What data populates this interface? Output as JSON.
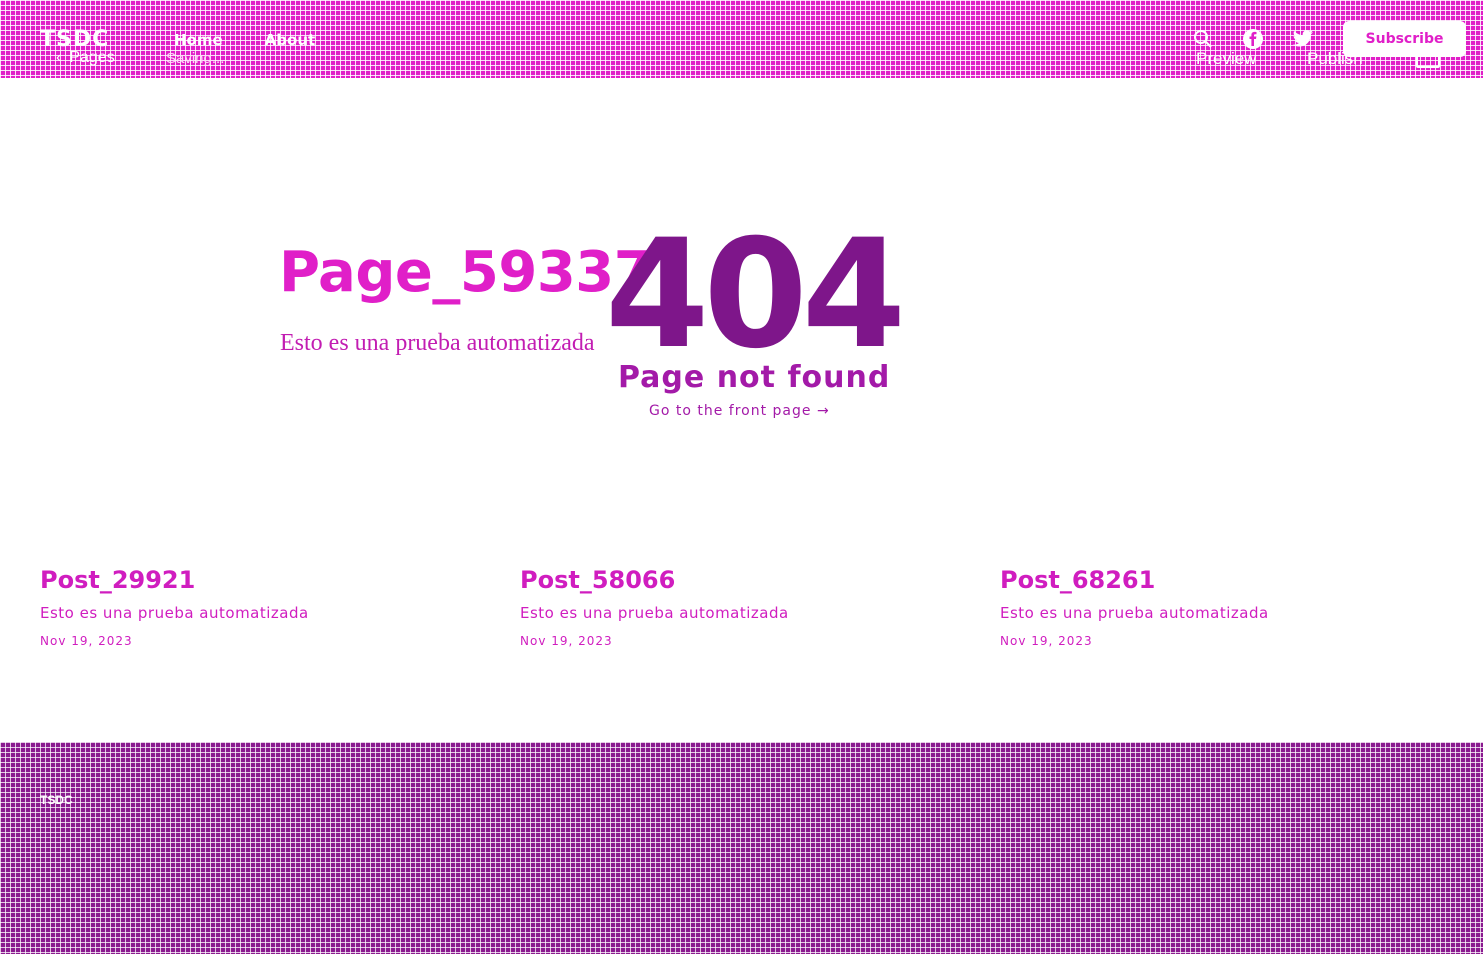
{
  "header": {
    "logo": "TSDC",
    "nav": [
      {
        "label": "Home"
      },
      {
        "label": "About"
      }
    ],
    "editor": {
      "back_arrow": "‹",
      "back_label": "Pages",
      "status": "Saving...",
      "preview_label": "Preview",
      "publish_label": "Publish"
    },
    "icons": [
      "search-icon",
      "facebook-icon",
      "twitter-icon"
    ],
    "subscribe_label": "Subscribe"
  },
  "main": {
    "page_title": "Page_59337",
    "page_description": "Esto es una prueba automatizada",
    "error_code": "404",
    "error_message": "Page not found",
    "front_link": "Go to the front page →"
  },
  "posts": [
    {
      "title": "Post_29921",
      "excerpt": "Esto es una prueba automatizada",
      "date": "Nov 19, 2023"
    },
    {
      "title": "Post_58066",
      "excerpt": "Esto es una prueba automatizada",
      "date": "Nov 19, 2023"
    },
    {
      "title": "Post_68261",
      "excerpt": "Esto es una prueba automatizada",
      "date": "Nov 19, 2023"
    }
  ],
  "footer": {
    "brand": "TSDC"
  },
  "colors": {
    "header_bg": "#e01fc8",
    "footer_bg": "#8a1a8f",
    "accent": "#e01fc8",
    "error_code": "#7e168a"
  }
}
